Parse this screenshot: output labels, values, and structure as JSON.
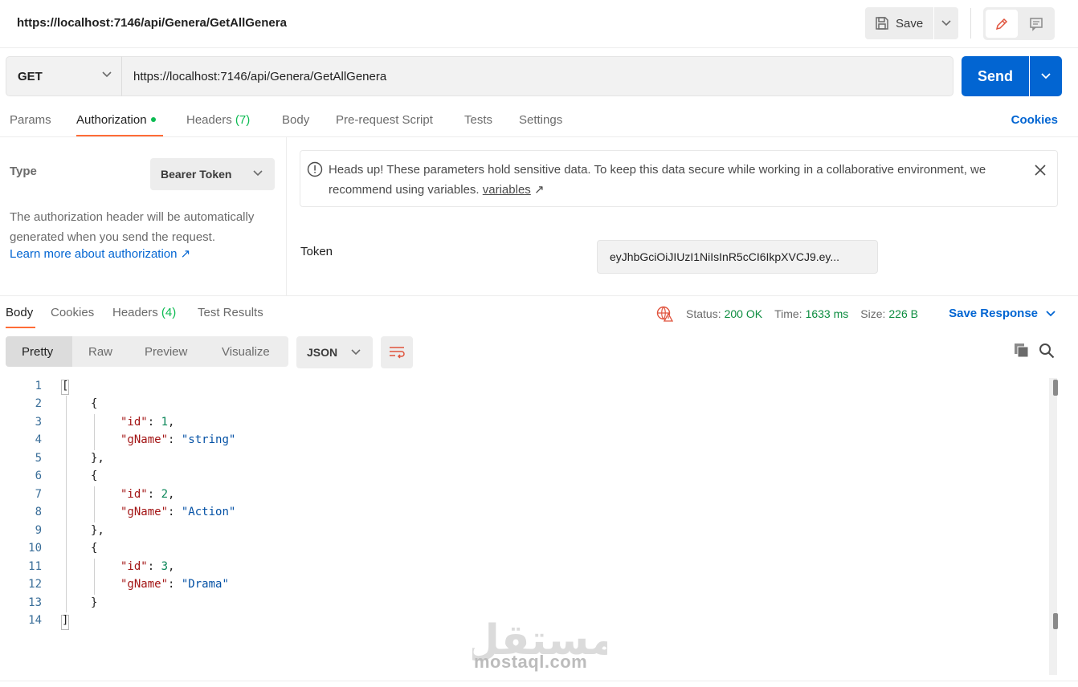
{
  "header": {
    "request_name": "https://localhost:7146/api/Genera/GetAllGenera",
    "save_label": "Save"
  },
  "request": {
    "method": "GET",
    "url": "https://localhost:7146/api/Genera/GetAllGenera",
    "send_label": "Send"
  },
  "request_tabs": {
    "params": "Params",
    "authorization": "Authorization",
    "headers": "Headers",
    "headers_count": "(7)",
    "body": "Body",
    "prerequest": "Pre-request Script",
    "tests": "Tests",
    "settings": "Settings",
    "cookies": "Cookies"
  },
  "auth": {
    "type_label": "Type",
    "type_value": "Bearer Token",
    "description": "The authorization header will be automatically generated when you send the request.",
    "learn_more": "Learn more about authorization ↗",
    "alert_text": "Heads up! These parameters hold sensitive data. To keep this data secure while working in a collaborative environment, we recommend using variables.",
    "alert_link": "variables",
    "alert_link_arrow": "↗",
    "token_label": "Token",
    "token_value": "eyJhbGciOiJIUzI1NiIsInR5cCI6IkpXVCJ9.ey..."
  },
  "response_tabs": {
    "body": "Body",
    "cookies": "Cookies",
    "headers": "Headers",
    "headers_count": "(4)",
    "test_results": "Test Results"
  },
  "response_meta": {
    "status_label": "Status:",
    "status_value": "200 OK",
    "time_label": "Time:",
    "time_value": "1633 ms",
    "size_label": "Size:",
    "size_value": "226 B",
    "save_response": "Save Response"
  },
  "view": {
    "options": [
      "Pretty",
      "Raw",
      "Preview",
      "Visualize"
    ],
    "format": "JSON"
  },
  "code": {
    "line_numbers": [
      "1",
      "2",
      "3",
      "4",
      "5",
      "6",
      "7",
      "8",
      "9",
      "10",
      "11",
      "12",
      "13",
      "14"
    ],
    "l1": "[",
    "l2": "{",
    "k_id": "\"id\"",
    "k_gname": "\"gName\"",
    "colon": ": ",
    "comma": ",",
    "v1_id": "1",
    "v1_name": "\"string\"",
    "l5": "},",
    "v2_id": "2",
    "v2_name": "\"Action\"",
    "v3_id": "3",
    "v3_name": "\"Drama\"",
    "l13": "}",
    "l14": "]"
  },
  "watermark": {
    "arabic": "مستقل",
    "latin": "mostaql.com"
  }
}
